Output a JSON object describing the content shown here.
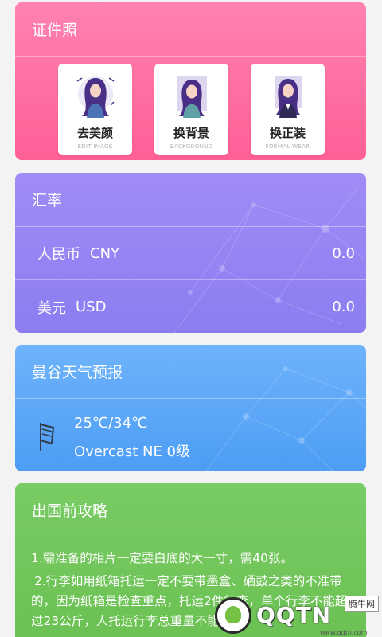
{
  "id_photo": {
    "title": "证件照",
    "tiles": [
      {
        "label": "去美颜",
        "sub": "EDIT IMAGE"
      },
      {
        "label": "换背景",
        "sub": "BACKGROUND"
      },
      {
        "label": "换正装",
        "sub": "FORMAL WEAR"
      }
    ]
  },
  "exchange": {
    "title": "汇率",
    "rows": [
      {
        "name": "人民币",
        "code": "CNY",
        "value": "0.0"
      },
      {
        "name": "美元",
        "code": "USD",
        "value": "0.0"
      }
    ]
  },
  "weather": {
    "title": "曼谷天气预报",
    "temp": "25℃/34℃",
    "desc": "Overcast NE 0级"
  },
  "guide": {
    "title": "出国前攻略",
    "p1": "1.需准备的相片一定要白底的大一寸，需40张。",
    "p2": "2.行李如用纸箱托运一定不要带墨盒、硒鼓之类的不准带的，因为纸箱是检查重点，托运2件行李，单个行李不能超过23公斤，人托运行李总重量不能超"
  },
  "watermark": {
    "badge": "腾牛网",
    "text": "QQTN",
    "url": "www.qqtn.com"
  },
  "colors": {
    "pink": "#ff6a9f",
    "purple": "#9585f3",
    "blue": "#5aa6f8",
    "green": "#72c65a"
  }
}
